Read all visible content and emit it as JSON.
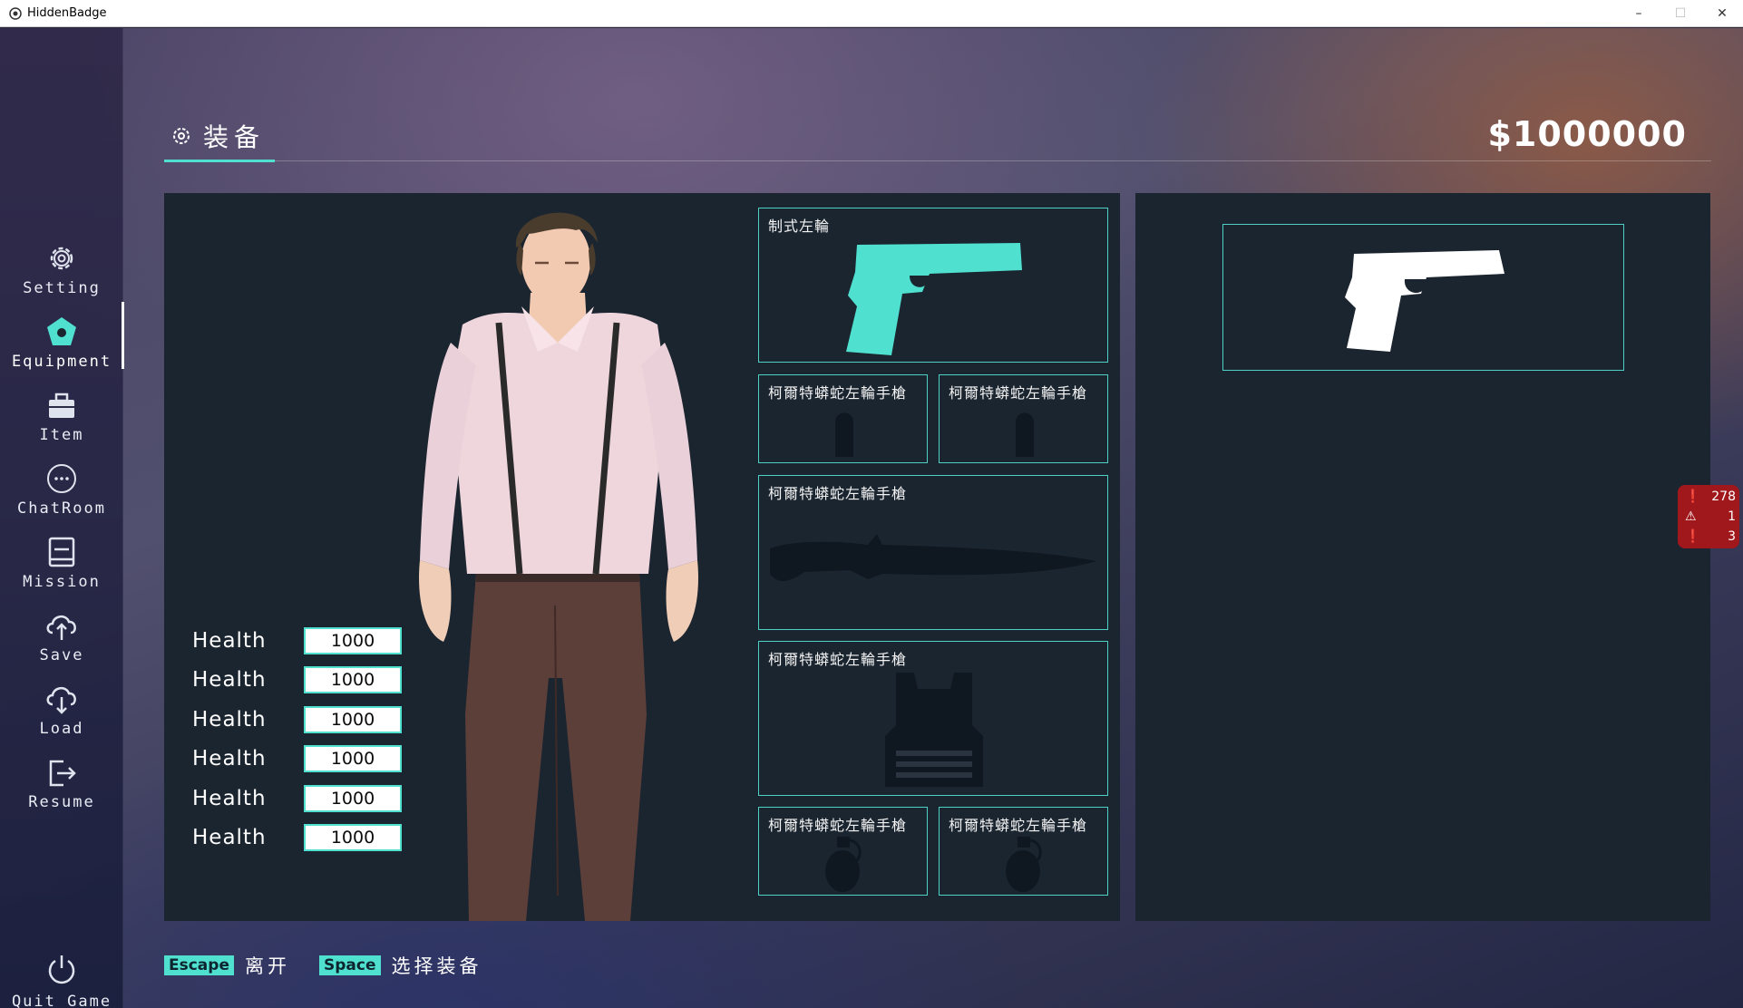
{
  "window": {
    "title": "HiddenBadge",
    "minimize": "–",
    "maximize": "☐",
    "close": "✕"
  },
  "sidebar": {
    "items": [
      {
        "label": "Setting",
        "icon": "gear-icon"
      },
      {
        "label": "Equipment",
        "icon": "pentagon-icon",
        "active": true
      },
      {
        "label": "Item",
        "icon": "toolbox-icon"
      },
      {
        "label": "ChatRoom",
        "icon": "chat-bubble-icon"
      },
      {
        "label": "Mission",
        "icon": "book-icon"
      },
      {
        "label": "Save",
        "icon": "cloud-upload-icon"
      },
      {
        "label": "Load",
        "icon": "cloud-download-icon"
      },
      {
        "label": "Resume",
        "icon": "exit-icon"
      }
    ],
    "quit_label": "Quit Game"
  },
  "header": {
    "title": "装备",
    "money": "$1000000"
  },
  "stats": [
    {
      "name": "Health",
      "value": "1000"
    },
    {
      "name": "Health",
      "value": "1000"
    },
    {
      "name": "Health",
      "value": "1000"
    },
    {
      "name": "Health",
      "value": "1000"
    },
    {
      "name": "Health",
      "value": "1000"
    },
    {
      "name": "Health",
      "value": "1000"
    }
  ],
  "slots": {
    "primary": {
      "label": "制式左輪",
      "icon": "pistol-icon"
    },
    "ammo_1": {
      "label": "柯爾特蟒蛇左輪手槍",
      "icon": "bullet-icon"
    },
    "ammo_2": {
      "label": "柯爾特蟒蛇左輪手槍",
      "icon": "bullet-icon"
    },
    "melee": {
      "label": "柯爾特蟒蛇左輪手槍",
      "icon": "knife-icon"
    },
    "armor": {
      "label": "柯爾特蟒蛇左輪手槍",
      "icon": "vest-icon"
    },
    "grenade_1": {
      "label": "柯爾特蟒蛇左輪手槍",
      "icon": "grenade-icon"
    },
    "grenade_2": {
      "label": "柯爾特蟒蛇左輪手槍",
      "icon": "grenade-icon"
    }
  },
  "notifications": {
    "errors": "278",
    "warnings": "1",
    "alerts": "3"
  },
  "hints": [
    {
      "key": "Escape",
      "text": "离开"
    },
    {
      "key": "Space",
      "text": "选择装备"
    }
  ],
  "colors": {
    "accent": "#4fe0d0",
    "panel": "#1b2530",
    "badge": "#a0181c"
  }
}
